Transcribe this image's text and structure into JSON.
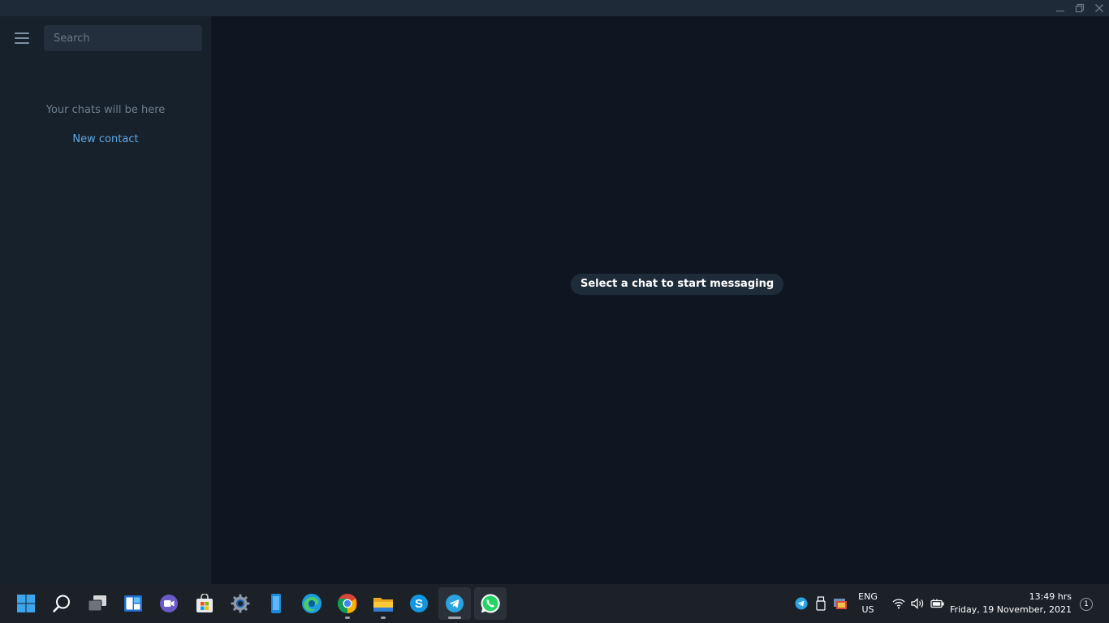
{
  "window": {
    "controls": [
      "minimize",
      "restore",
      "close"
    ]
  },
  "sidebar": {
    "search_placeholder": "Search",
    "empty_text": "Your chats will be here",
    "new_contact_label": "New contact"
  },
  "main": {
    "empty_prompt": "Select a chat to start messaging"
  },
  "taskbar": {
    "apps": [
      {
        "name": "start-menu-icon"
      },
      {
        "name": "search-icon"
      },
      {
        "name": "task-view-icon"
      },
      {
        "name": "widgets-icon"
      },
      {
        "name": "teams-chat-icon"
      },
      {
        "name": "microsoft-store-icon"
      },
      {
        "name": "settings-icon"
      },
      {
        "name": "phone-link-icon"
      },
      {
        "name": "edge-icon"
      },
      {
        "name": "chrome-icon"
      },
      {
        "name": "file-explorer-icon"
      },
      {
        "name": "skype-icon"
      },
      {
        "name": "telegram-icon",
        "active": true
      },
      {
        "name": "whatsapp-icon",
        "active": true
      }
    ],
    "tray": {
      "lang_line1": "ENG",
      "lang_line2": "US",
      "time": "13:49 hrs",
      "date": "Friday, 19 November, 2021",
      "notification_count": "1"
    }
  },
  "colors": {
    "sidebar_bg": "#17212b",
    "main_bg": "#0e1621",
    "accent": "#5fa8e6",
    "taskbar_bg": "#1c2127"
  }
}
